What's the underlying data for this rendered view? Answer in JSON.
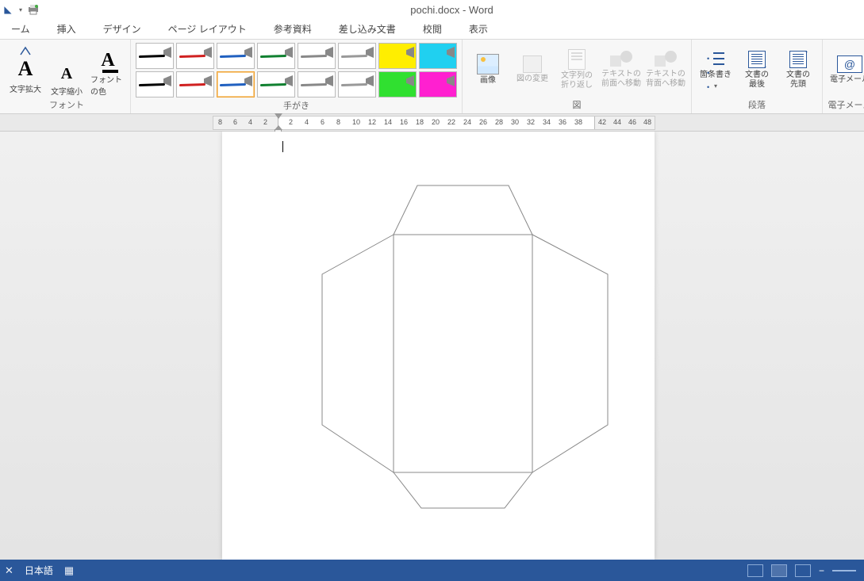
{
  "window": {
    "title": "pochi.docx - Word"
  },
  "tabs": [
    "ーム",
    "挿入",
    "デザイン",
    "ページ レイアウト",
    "参考資料",
    "差し込み文書",
    "校閲",
    "表示"
  ],
  "ribbon": {
    "font": {
      "grow": "文字拡大",
      "shrink": "文字縮小",
      "color": "フォントの色",
      "group_label": "フォント"
    },
    "ink": {
      "group_label": "手がき",
      "colors_row1": [
        "#000000",
        "#d02020",
        "#2060c0",
        "#108030",
        "#888888",
        "#999999",
        "#ffee00",
        "#20d0f0"
      ],
      "colors_row2": [
        "#000000",
        "#d02020",
        "#2060c0",
        "#108030",
        "#888888",
        "#999999",
        "#30e030",
        "#ff20d0"
      ],
      "fill_indices": [
        6,
        7,
        14,
        15
      ]
    },
    "picture": {
      "image": "画像",
      "change": "図の変更",
      "wrap": "文字列の\n折り返し",
      "move_back": "テキストの\n前面へ移動",
      "move_front": "テキストの\n背面へ移動",
      "group_label": "図"
    },
    "paragraph": {
      "bullets": "箇条書き",
      "doc_end": "文書の\n最後",
      "doc_start": "文書の\n先頭",
      "group_label": "段落"
    },
    "email": {
      "label": "電子メール",
      "group_label": "電子メール"
    }
  },
  "ruler": {
    "neg": [
      "8",
      "6",
      "4",
      "2"
    ],
    "pos": [
      "2",
      "4",
      "6",
      "8",
      "10",
      "12",
      "14",
      "16",
      "18",
      "20",
      "22",
      "24",
      "26",
      "28",
      "30",
      "32",
      "34",
      "36",
      "38"
    ],
    "end": [
      "42",
      "44",
      "46",
      "48"
    ]
  },
  "status": {
    "language": "日本語"
  }
}
